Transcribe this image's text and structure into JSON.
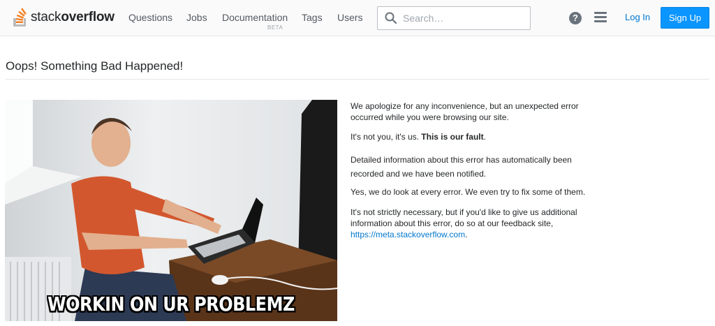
{
  "header": {
    "logo_text_light": "stack",
    "logo_text_bold": "overflow",
    "nav": [
      {
        "label": "Questions"
      },
      {
        "label": "Jobs"
      },
      {
        "label": "Documentation"
      },
      {
        "label": "Tags"
      },
      {
        "label": "Users"
      }
    ],
    "documentation_badge": "BETA",
    "search_placeholder": "Search…",
    "help_icon_glyph": "?",
    "login_label": "Log In",
    "signup_label": "Sign Up"
  },
  "main": {
    "title": "Oops! Something Bad Happened!",
    "image_caption": "WORKIN ON UR PROBLEMZ",
    "paragraphs": {
      "p1": "We apologize for any inconvenience, but an unexpected error occurred while you were browsing our site.",
      "p2_start": "It's not you, it's us. ",
      "p2_bold": "This is our fault",
      "p2_end": ".",
      "p3": "Detailed information about this error has automatically been recorded and we have been notified.",
      "p4": "Yes, we do look at every error. We even try to fix some of them.",
      "p5": "It's not strictly necessary, but if you'd like to give us additional information about this error, do so at our feedback site,",
      "feedback_link": "https://meta.stackoverflow.com",
      "p5_end": "."
    }
  },
  "colors": {
    "brand_orange": "#f48024",
    "link_blue": "#0077cc",
    "signup_blue": "#0a95ff"
  }
}
